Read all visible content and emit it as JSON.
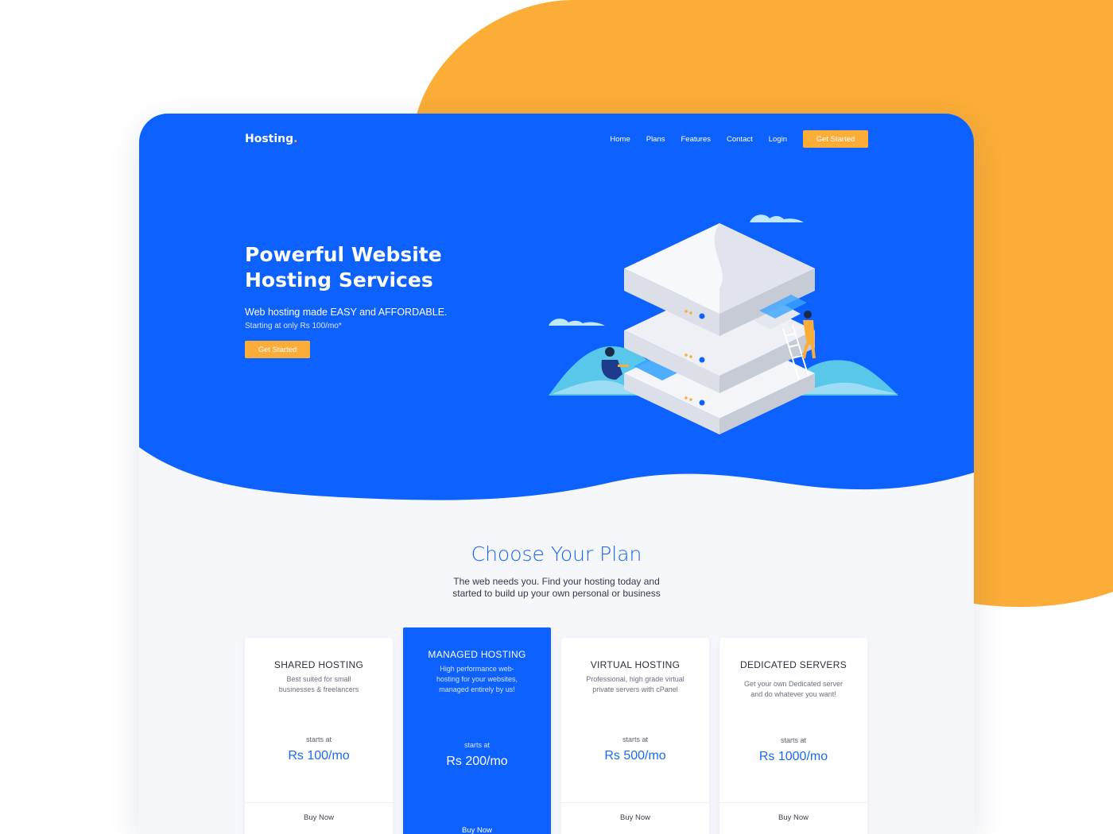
{
  "colors": {
    "brand_blue": "#0d62ff",
    "accent_orange": "#fbad37",
    "heading_blue": "#1565f5",
    "page_background": "#f6f7fb"
  },
  "header": {
    "logo_text": "Hosting",
    "logo_dot": ".",
    "nav": [
      "Home",
      "Plans",
      "Features",
      "Contact",
      "Login"
    ],
    "cta_label": "Get Started"
  },
  "hero": {
    "title_line1": "Powerful Website",
    "title_line2": "Hosting Services",
    "subtitle": "Web hosting made EASY and AFFORDABLE.",
    "note": "Starting at only Rs 100/mo*",
    "cta_label": "Get Started",
    "illustration": "isometric server stack with workers and clouds"
  },
  "plans": {
    "title": "Choose Your Plan",
    "subtitle_line1": "The web needs you. Find your hosting today and",
    "subtitle_line2": "started to build up your own personal or business",
    "cards": [
      {
        "name": "SHARED HOSTING",
        "desc_line1": "Best suited for small",
        "desc_line2": "businesses & freelancers",
        "starts_label": "starts at",
        "price": "Rs 100/mo",
        "buy_label": "Buy Now",
        "featured": false
      },
      {
        "name": "MANAGED HOSTING",
        "desc_line1": "High performance web-",
        "desc_line2": "hosting for your websites,",
        "desc_line3": "managed entirely by us!",
        "starts_label": "starts at",
        "price": "Rs 200/mo",
        "buy_label": "Buy Now",
        "featured": true
      },
      {
        "name": "VIRTUAL HOSTING",
        "desc_line1": "Professional, high grade virtual",
        "desc_line2": "private servers with cPanel",
        "starts_label": "starts at",
        "price": "Rs 500/mo",
        "buy_label": "Buy Now",
        "featured": false
      },
      {
        "name": "DEDICATED SERVERS",
        "desc_line1": "Get your own Dedicated server",
        "desc_line2": "and do whatever you want!",
        "starts_label": "starts at",
        "price": "Rs 1000/mo",
        "buy_label": "Buy Now",
        "featured": false
      }
    ]
  }
}
